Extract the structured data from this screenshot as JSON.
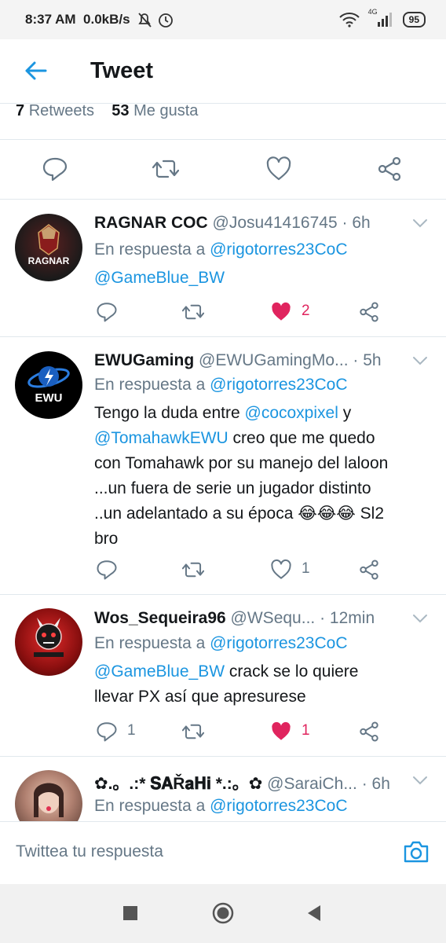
{
  "status_bar": {
    "time": "8:37 AM",
    "speed": "0.0kB/s",
    "battery": "95",
    "network": "4G"
  },
  "header": {
    "title": "Tweet"
  },
  "stats": {
    "retweets_count": "7",
    "retweets_label": "Retweets",
    "likes_count": "53",
    "likes_label": "Me gusta"
  },
  "tweets": [
    {
      "name": "RAGNAR COC",
      "handle": "@Josu41416745",
      "dot": "·",
      "time": "6h",
      "reply_prefix": "En respuesta a",
      "reply_to": "@rigotorres23CoC",
      "body_mention": "@GameBlue_BW",
      "body_text": "",
      "reply_count": "",
      "retweet_count": "",
      "like_count": "2",
      "liked": true,
      "avatar_text": "RAGNAR"
    },
    {
      "name": "EWUGaming",
      "handle": "@EWUGamingMo...",
      "dot": "·",
      "time": "5h",
      "reply_prefix": "En respuesta a",
      "reply_to": "@rigotorres23CoC",
      "body_pre": "Tengo la duda entre",
      "body_mention1": "@cocoxpixel",
      "body_mid": "y",
      "body_mention2": "@TomahawkEWU",
      "body_post": "creo que me quedo con Tomahawk por su manejo del laloon ...un fuera de serie un jugador distinto ..un adelantado a su época 😂😂😂 Sl2 bro",
      "reply_count": "",
      "retweet_count": "",
      "like_count": "1",
      "liked": false,
      "avatar_text": "EWU"
    },
    {
      "name": "Wos_Sequeira96",
      "handle": "@WSequ...",
      "dot": "·",
      "time": "12min",
      "reply_prefix": "En respuesta a",
      "reply_to": "@rigotorres23CoC",
      "body_mention": "@GameBlue_BW",
      "body_text": "crack  se lo quiere llevar PX así que apresurese",
      "reply_count": "1",
      "retweet_count": "",
      "like_count": "1",
      "liked": true
    },
    {
      "name": "✿.。.:* 𝐒𝐀Ř𝐚𝐇𝐢 *.:。✿",
      "handle": "@SaraiCh...",
      "dot": "·",
      "time": "6h",
      "reply_prefix": "En respuesta a",
      "reply_to": "@rigotorres23CoC"
    }
  ],
  "reply_bar": {
    "placeholder": "Twittea tu respuesta"
  },
  "colors": {
    "accent": "#1b95e0",
    "like": "#e0245e",
    "muted": "#657786",
    "text": "#14171a",
    "border": "#e1e8ed"
  }
}
